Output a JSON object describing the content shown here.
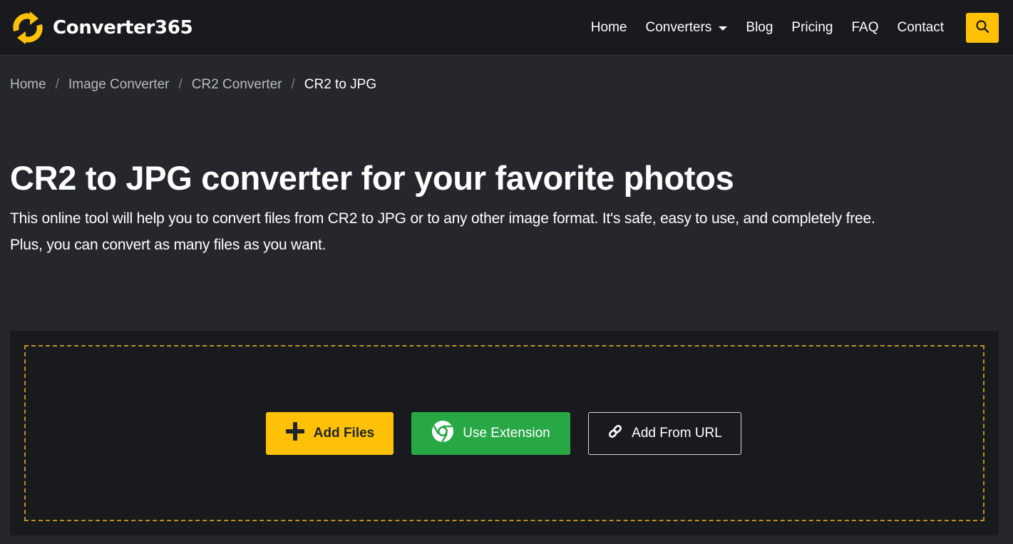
{
  "brand": {
    "name": "Converter365",
    "logo_icon": "sync-arrows-icon",
    "accent_color": "#ffc107"
  },
  "nav": {
    "items": [
      {
        "label": "Home"
      },
      {
        "label": "Converters",
        "has_dropdown": true
      },
      {
        "label": "Blog"
      },
      {
        "label": "Pricing"
      },
      {
        "label": "FAQ"
      },
      {
        "label": "Contact"
      }
    ],
    "search_icon": "search-icon"
  },
  "breadcrumb": {
    "items": [
      {
        "label": "Home"
      },
      {
        "label": "Image Converter"
      },
      {
        "label": "CR2 Converter"
      },
      {
        "label": "CR2 to JPG",
        "active": true
      }
    ],
    "separator": "/"
  },
  "hero": {
    "title": "CR2 to JPG converter for your favorite photos",
    "description_line1": "This online tool will help you to convert files from CR2 to JPG or to any other image format. It's safe, easy to use, and completely free.",
    "description_line2": "Plus, you can convert as many files as you want."
  },
  "upload": {
    "add_files_label": "Add Files",
    "add_files_icon": "plus-icon",
    "use_extension_label": "Use Extension",
    "use_extension_icon": "chrome-icon",
    "add_url_label": "Add From URL",
    "add_url_icon": "link-icon",
    "colors": {
      "add_files": "#ffc107",
      "use_extension": "#28a745",
      "dropzone_border": "#b7901f"
    }
  }
}
